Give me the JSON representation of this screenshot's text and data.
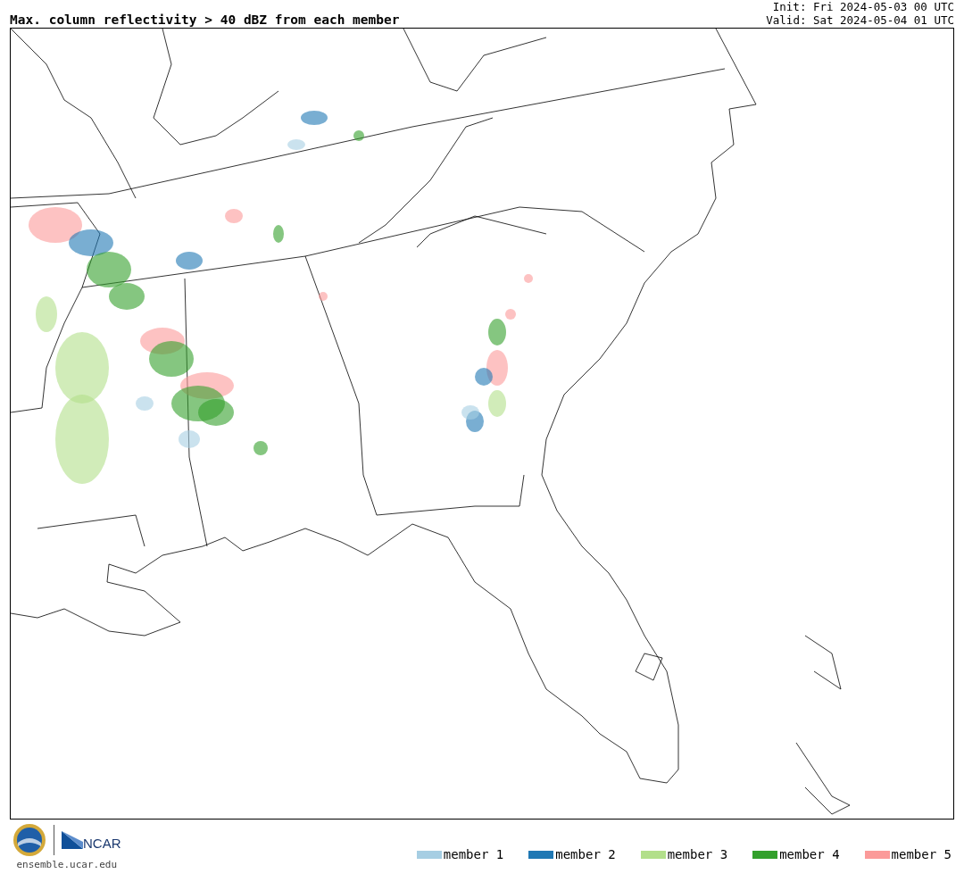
{
  "title": "Max. column reflectivity > 40 dBZ from each member",
  "init": "Init: Fri 2024-05-03 00 UTC",
  "valid": "Valid: Sat 2024-05-04 01 UTC",
  "logo_text": "NCAR",
  "site": "ensemble.ucar.edu",
  "legend": [
    {
      "label": "member 1",
      "color": "#a6cee3"
    },
    {
      "label": "member 2",
      "color": "#1f78b4"
    },
    {
      "label": "member 3",
      "color": "#b2df8a"
    },
    {
      "label": "member 4",
      "color": "#33a02c"
    },
    {
      "label": "member 5",
      "color": "#fb9a99"
    }
  ]
}
